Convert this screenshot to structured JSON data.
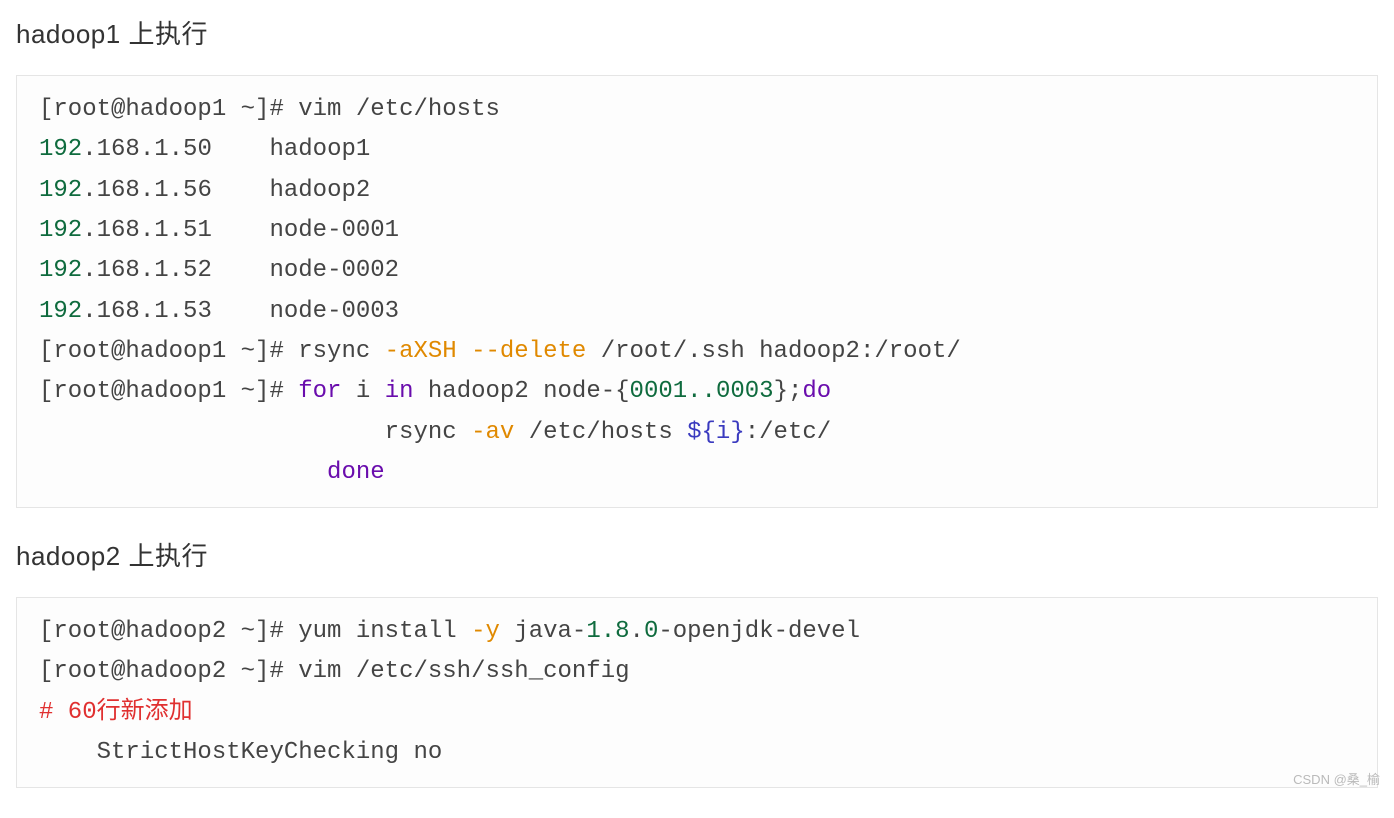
{
  "section1": {
    "title": "hadoop1 上执行",
    "prompt": "[root@hadoop1 ~]#",
    "cmd_vim": "vim /etc/hosts",
    "hosts": [
      {
        "ip_a": "192",
        "ip_b": ".168.1.50",
        "name": "hadoop1"
      },
      {
        "ip_a": "192",
        "ip_b": ".168.1.56",
        "name": "hadoop2"
      },
      {
        "ip_a": "192",
        "ip_b": ".168.1.51",
        "name": "node-0001"
      },
      {
        "ip_a": "192",
        "ip_b": ".168.1.52",
        "name": "node-0002"
      },
      {
        "ip_a": "192",
        "ip_b": ".168.1.53",
        "name": "node-0003"
      }
    ],
    "rsync1_a": "rsync ",
    "rsync1_b": "-aXSH --delete",
    "rsync1_c": " /root/.ssh hadoop2:/root/",
    "for_a": "for",
    "for_b": " i ",
    "for_c": "in",
    "for_d": " hadoop2 node-{",
    "for_e": "0001..0003",
    "for_f": "};",
    "for_g": "do",
    "rsync2_pad": "                        ",
    "rsync2_a": "rsync ",
    "rsync2_b": "-av",
    "rsync2_c": " /etc/hosts ",
    "rsync2_d": "${i}",
    "rsync2_e": ":/etc/",
    "done_pad": "                    ",
    "done": "done"
  },
  "section2": {
    "title": "hadoop2 上执行",
    "prompt": "[root@hadoop2 ~]#",
    "cmd_yum_a": "yum install ",
    "cmd_yum_b": "-y",
    "cmd_yum_c": " java-",
    "cmd_yum_d": "1.8",
    "cmd_yum_e": ".",
    "cmd_yum_f": "0",
    "cmd_yum_g": "-openjdk-devel",
    "cmd_vim": "vim /etc/ssh/ssh_config",
    "comment": "# 60行新添加",
    "strict_pad": "    ",
    "strict": "StrictHostKeyChecking no"
  },
  "watermark": "CSDN @桑_榆"
}
